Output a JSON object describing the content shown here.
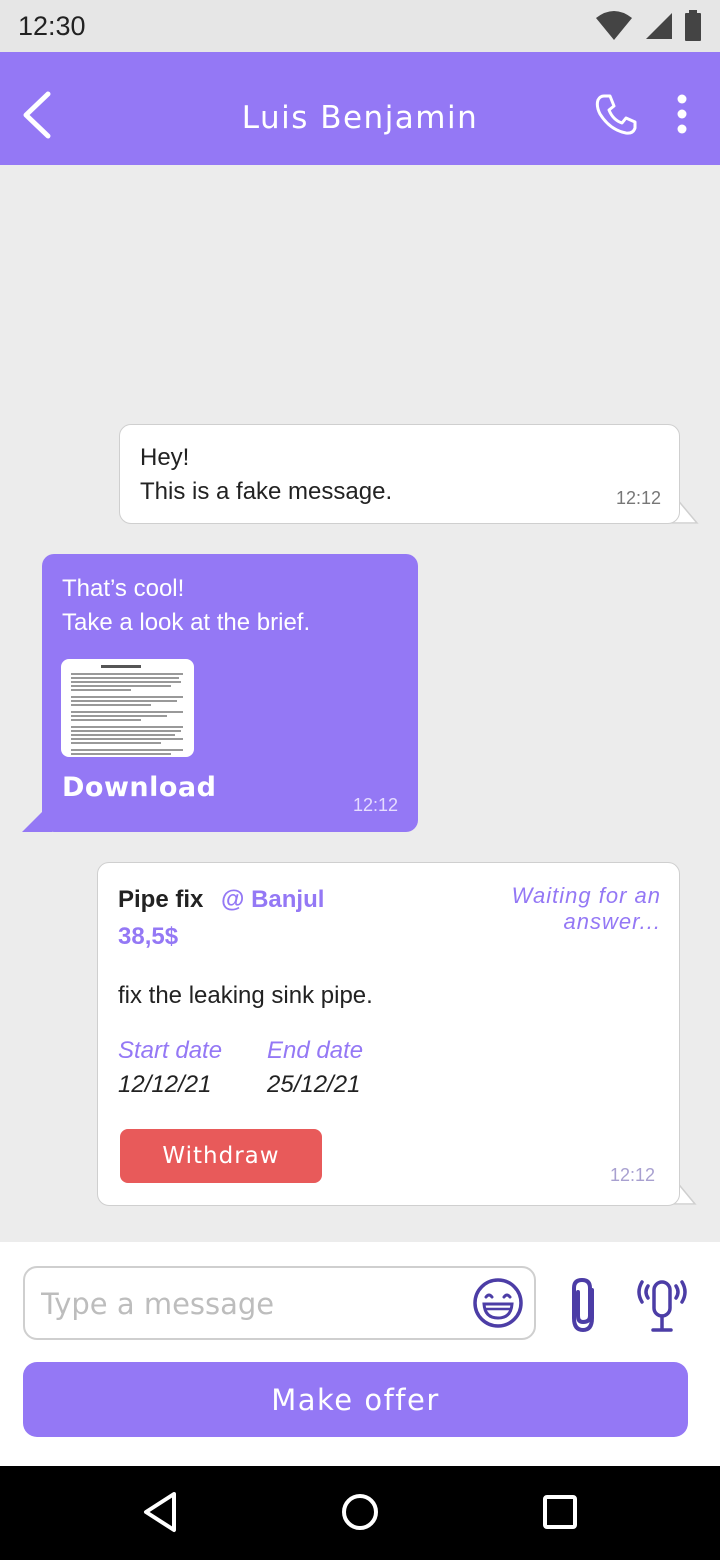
{
  "status_bar": {
    "time": "12:30"
  },
  "header": {
    "contact_name": "Luis Benjamin"
  },
  "messages": {
    "m1": {
      "line1": "Hey!",
      "line2": "This is a fake message.",
      "time": "12:12"
    },
    "m2": {
      "line1": "That’s cool!",
      "line2": "Take a look at the brief.",
      "download_label": "Download",
      "time": "12:12"
    },
    "offer": {
      "title": "Pipe fix",
      "location": "@ Banjul",
      "price": "38,5$",
      "status": "Waiting for an answer...",
      "description": "fix the leaking sink pipe.",
      "start_label": "Start date",
      "start_value": "12/12/21",
      "end_label": "End date",
      "end_value": "25/12/21",
      "withdraw_label": "Withdraw",
      "time": "12:12"
    }
  },
  "composer": {
    "placeholder": "Type a message",
    "make_offer_label": "Make offer"
  },
  "colors": {
    "accent": "#9478f5",
    "withdraw": "#e85a5a",
    "status_bar": "#e6e6e6",
    "chat_bg": "#ececec"
  },
  "icons": [
    "wifi-icon",
    "signal-icon",
    "battery-icon",
    "back-arrow-icon",
    "phone-icon",
    "more-vert-icon",
    "emoji-icon",
    "attach-icon",
    "microphone-icon",
    "nav-back-icon",
    "nav-home-icon",
    "nav-recents-icon"
  ]
}
